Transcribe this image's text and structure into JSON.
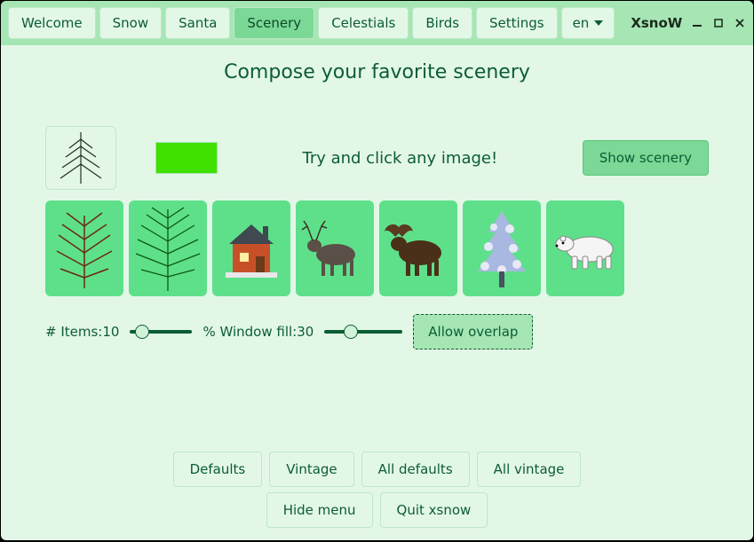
{
  "app_title": "XsnoW",
  "tabs": [
    "Welcome",
    "Snow",
    "Santa",
    "Scenery",
    "Celestials",
    "Birds",
    "Settings"
  ],
  "active_tab_index": 3,
  "language": {
    "label": "en"
  },
  "heading": "Compose your favorite scenery",
  "color_swatch_hex": "#40e000",
  "hint_text": "Try and click any image!",
  "show_button": "Show  scenery",
  "scenery_items": [
    {
      "name": "bare-tree"
    },
    {
      "name": "green-tree"
    },
    {
      "name": "house"
    },
    {
      "name": "reindeer"
    },
    {
      "name": "moose"
    },
    {
      "name": "snowy-tree"
    },
    {
      "name": "polar-bear"
    }
  ],
  "sliders": {
    "items_label": "# Items:",
    "items_value": 10,
    "items_text": "# Items:10",
    "fill_label": "% Window fill:",
    "fill_value": 30,
    "fill_text": "% Window fill:30"
  },
  "allow_overlap": "Allow overlap",
  "bottom_buttons_row1": [
    "Defaults",
    "Vintage",
    "All defaults",
    "All vintage"
  ],
  "bottom_buttons_row2": [
    "Hide menu",
    "Quit xsnow"
  ]
}
